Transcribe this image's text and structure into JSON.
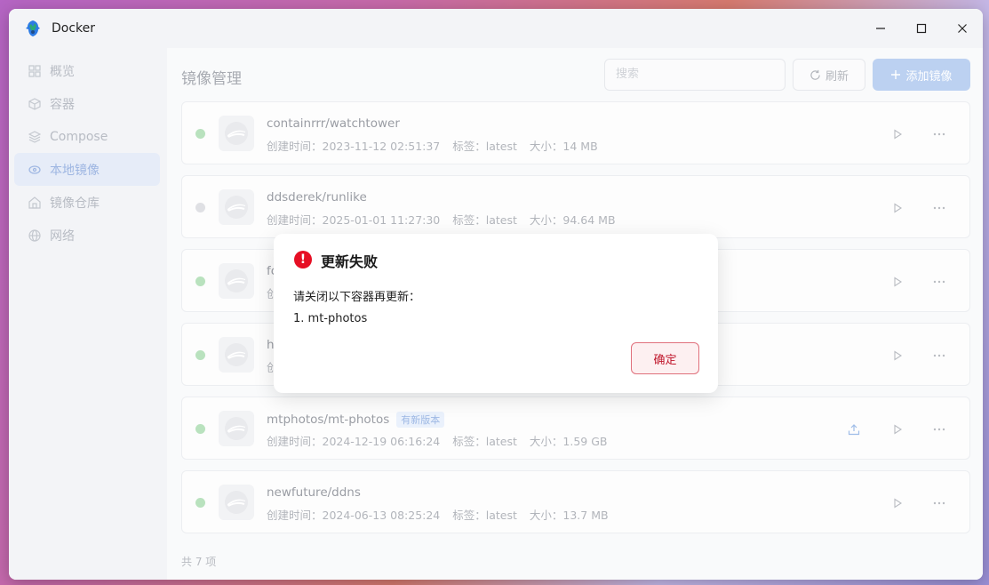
{
  "window": {
    "title": "Docker"
  },
  "sidebar": {
    "items": [
      {
        "label": "概览",
        "icon": "grid-icon",
        "active": false
      },
      {
        "label": "容器",
        "icon": "cube-icon",
        "active": false
      },
      {
        "label": "Compose",
        "icon": "layers-icon",
        "active": false
      },
      {
        "label": "本地镜像",
        "icon": "disk-icon",
        "active": true
      },
      {
        "label": "镜像仓库",
        "icon": "home-icon",
        "active": false
      },
      {
        "label": "网络",
        "icon": "globe-icon",
        "active": false
      }
    ]
  },
  "main": {
    "title": "镜像管理",
    "search_placeholder": "搜索",
    "refresh_label": "刷新",
    "add_label": "添加镜像",
    "footer_count": "共 7 项"
  },
  "images": [
    {
      "name": "containrrr/watchtower",
      "created": "创建时间：2023-11-12 02:51:37",
      "tag": "标签：latest",
      "size": "大小：14 MB",
      "status": "green",
      "badge": ""
    },
    {
      "name": "ddsderek/runlike",
      "created": "创建时间：2025-01-01 11:27:30",
      "tag": "标签：latest",
      "size": "大小：94.64 MB",
      "status": "grey",
      "badge": ""
    },
    {
      "name": "fo",
      "created": "创",
      "tag": "",
      "size": "",
      "status": "green",
      "badge": ""
    },
    {
      "name": "h",
      "created": "创",
      "tag": "",
      "size": "",
      "status": "green",
      "badge": ""
    },
    {
      "name": "mtphotos/mt-photos",
      "created": "创建时间：2024-12-19 06:16:24",
      "tag": "标签：latest",
      "size": "大小：1.59 GB",
      "status": "green",
      "badge": "有新版本"
    },
    {
      "name": "newfuture/ddns",
      "created": "创建时间：2024-06-13 08:25:24",
      "tag": "标签：latest",
      "size": "大小：13.7 MB",
      "status": "green",
      "badge": ""
    }
  ],
  "dialog": {
    "title": "更新失败",
    "message": "请关闭以下容器再更新：",
    "item": "1. mt-photos",
    "ok_label": "确定"
  },
  "colors": {
    "accent": "#3b7ee0",
    "error": "#e60f24",
    "status_green": "#b9e2be"
  }
}
